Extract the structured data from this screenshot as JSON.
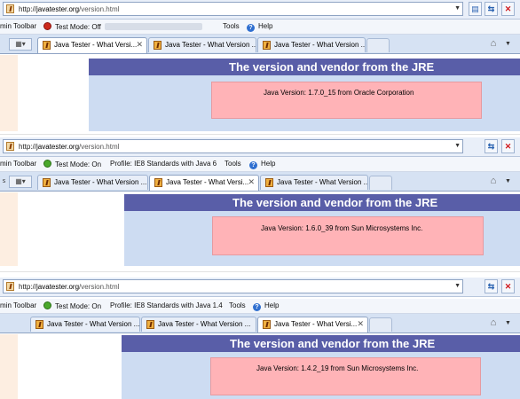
{
  "panels": [
    {
      "url_domain": "javatester.org",
      "url_path": "/version.html",
      "url_prefix": "http://",
      "toolbar": {
        "admin": "min Toolbar",
        "test_mode": "Test Mode: Off",
        "profile": "",
        "tools": "Tools",
        "help": "Help"
      },
      "tabs": [
        {
          "label": "Java Tester - What Versi...",
          "active": true
        },
        {
          "label": "Java Tester - What Version ...",
          "active": false
        },
        {
          "label": "Java Tester - What Version ...",
          "active": false
        }
      ],
      "header": "The version and vendor from the JRE",
      "version_text": "Java Version: 1.7.0_15  from Oracle Corporation"
    },
    {
      "url_domain": "javatester.org",
      "url_path": "/version.html",
      "url_prefix": "http://",
      "toolbar": {
        "admin": "min Toolbar",
        "test_mode": "Test Mode: On",
        "profile": "Profile: IE8 Standards with Java 6",
        "tools": "Tools",
        "help": "Help"
      },
      "tabs": [
        {
          "label": "Java Tester - What Version ...",
          "active": false
        },
        {
          "label": "Java Tester - What Versi...",
          "active": true
        },
        {
          "label": "Java Tester - What Version ...",
          "active": false
        }
      ],
      "header": "The version and vendor from the JRE",
      "version_text": "Java Version: 1.6.0_39  from Sun Microsystems Inc."
    },
    {
      "url_domain": "javatester.org",
      "url_path": "/version.html",
      "url_prefix": "http://",
      "toolbar": {
        "admin": "min Toolbar",
        "test_mode": "Test Mode: On",
        "profile": "Profile: IE8 Standards with Java 1.4",
        "tools": "Tools",
        "help": "Help"
      },
      "tabs": [
        {
          "label": "Java Tester - What Version ...",
          "active": false
        },
        {
          "label": "Java Tester - What Version ...",
          "active": false
        },
        {
          "label": "Java Tester - What Versi...",
          "active": true
        }
      ],
      "header": "The version and vendor from the JRE",
      "version_text": "Java Version: 1.4.2_19  from Sun Microsystems Inc."
    }
  ],
  "icons": {
    "compat": "compat-view-icon",
    "refresh": "refresh-icon",
    "stop": "stop-icon",
    "home": "home-icon"
  },
  "colors": {
    "header_bg": "#595ea8",
    "content_bg": "#cddcf2",
    "version_box": "#ffb3b7",
    "stop_red": "#d0181c"
  }
}
